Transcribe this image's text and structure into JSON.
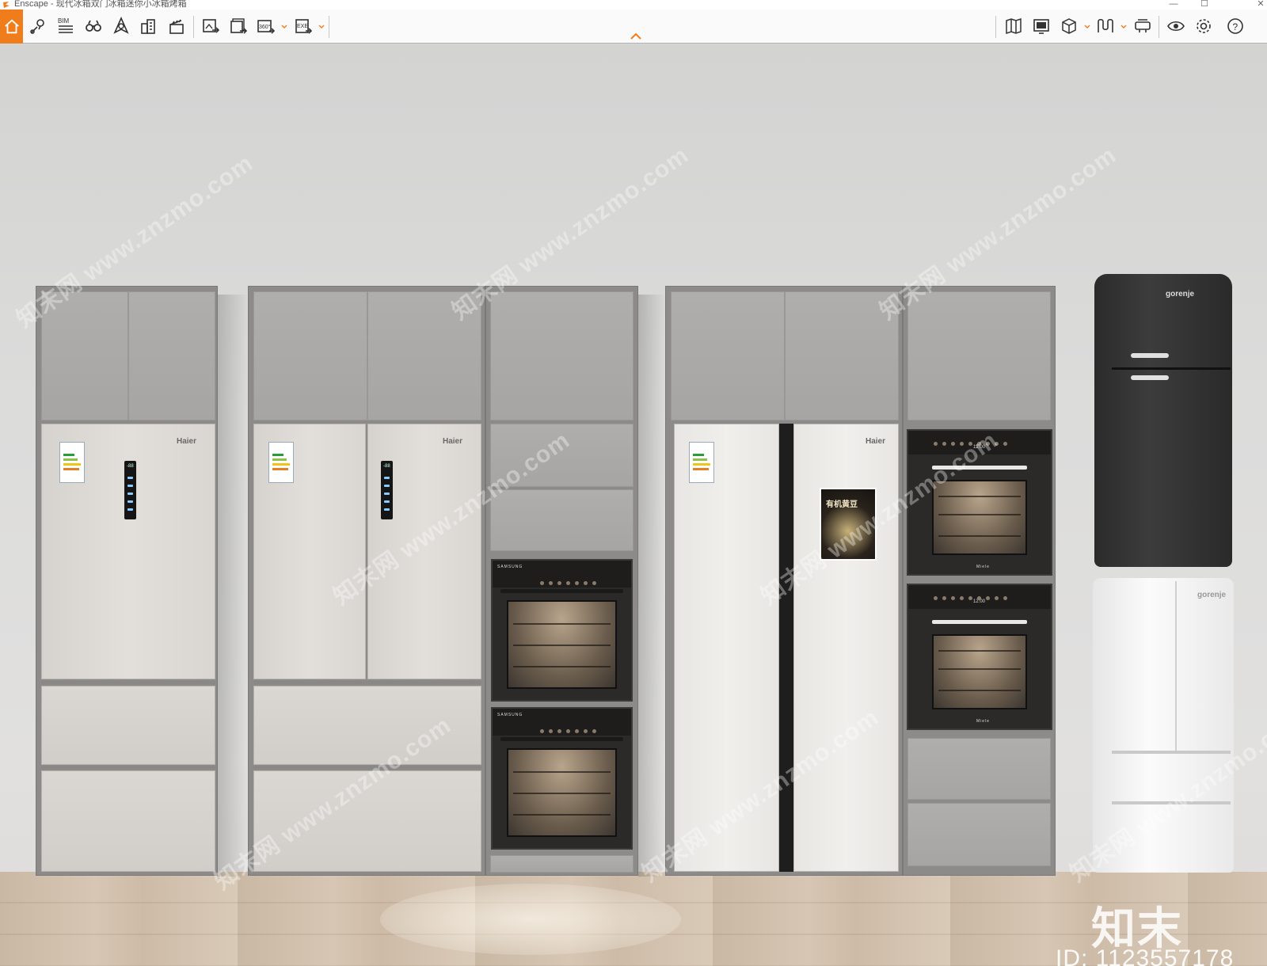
{
  "window": {
    "title": "Enscape - 现代冰箱双门冰箱迷你小冰箱烤箱",
    "controls": {
      "minimize": "—",
      "maximize": "☐",
      "close": "✕"
    }
  },
  "toolbar": {
    "accent_color": "#f07d1b",
    "left_tools": [
      {
        "name": "home-icon"
      },
      {
        "name": "location-pin-icon"
      },
      {
        "name": "bim-icon",
        "label": "BIM"
      },
      {
        "name": "binoculars-icon"
      },
      {
        "name": "compass-icon"
      },
      {
        "name": "buildings-icon"
      },
      {
        "name": "clapperboard-icon"
      },
      {
        "name": "render-image-icon"
      },
      {
        "name": "batch-render-icon"
      },
      {
        "name": "panorama-icon",
        "label": "360°"
      },
      {
        "name": "export-exe-icon",
        "label": "EXE"
      }
    ],
    "right_tools": [
      {
        "name": "map-icon"
      },
      {
        "name": "monitor-icon"
      },
      {
        "name": "cube-icon"
      },
      {
        "name": "material-icon"
      },
      {
        "name": "vr-headset-icon"
      },
      {
        "name": "eye-icon"
      },
      {
        "name": "settings-icon"
      },
      {
        "name": "help-icon"
      }
    ]
  },
  "scene": {
    "brands": {
      "haier_1": "Haier",
      "haier_2": "Haier",
      "haier_3": "Haier",
      "samsung_1": "SAMSUNG",
      "samsung_2": "SAMSUNG",
      "miele_1": "Miele",
      "miele_2": "Miele",
      "gorenje_black": "gorenje",
      "gorenje_white": "gorenje"
    },
    "oven_clock": "12:00",
    "fridge_display": "-88",
    "poster_text": "有机黄豆",
    "watermark_text": "知末网 www.znzmo.com",
    "corner_logo": "知末",
    "corner_id": "ID: 1123557178"
  }
}
